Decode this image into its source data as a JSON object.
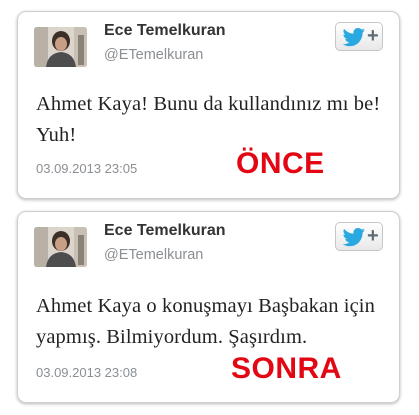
{
  "colors": {
    "stamp_red": "#e30613",
    "twitter_blue": "#2aa9e0",
    "name_text": "#333333",
    "muted_text": "#8a8f94"
  },
  "tweets": [
    {
      "author_name": "Ece Temelkuran",
      "author_handle": "@ETemelkuran",
      "text": "Ahmet Kaya! Bunu da kullandınız mı be! Yuh!",
      "timestamp": "03.09.2013 23:05",
      "label": "ÖNCE",
      "follow_icon": "twitter-bird-plus-icon",
      "follow_plus": "+"
    },
    {
      "author_name": "Ece Temelkuran",
      "author_handle": "@ETemelkuran",
      "text": "Ahmet Kaya o konuşmayı Başbakan için yapmış. Bilmiyordum. Şaşırdım.",
      "timestamp": "03.09.2013 23:08",
      "label": "SONRA",
      "follow_icon": "twitter-bird-plus-icon",
      "follow_plus": "+"
    }
  ]
}
